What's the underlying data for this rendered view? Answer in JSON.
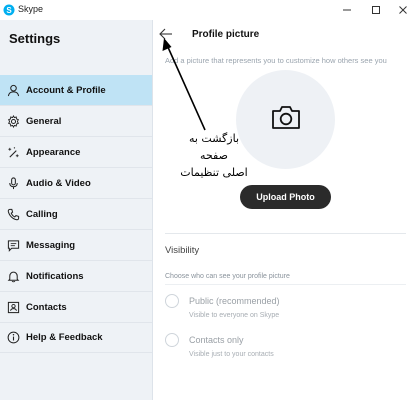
{
  "window": {
    "app_title": "Skype"
  },
  "sidebar": {
    "title": "Settings",
    "items": [
      {
        "label": "Account & Profile",
        "icon": "person-icon"
      },
      {
        "label": "General",
        "icon": "gear-icon"
      },
      {
        "label": "Appearance",
        "icon": "magic-wand-icon"
      },
      {
        "label": "Audio & Video",
        "icon": "microphone-icon"
      },
      {
        "label": "Calling",
        "icon": "phone-icon"
      },
      {
        "label": "Messaging",
        "icon": "chat-icon"
      },
      {
        "label": "Notifications",
        "icon": "bell-icon"
      },
      {
        "label": "Contacts",
        "icon": "contact-card-icon"
      },
      {
        "label": "Help & Feedback",
        "icon": "info-icon"
      }
    ],
    "active_index": 0
  },
  "main": {
    "title": "Profile picture",
    "subtitle": "Add a picture that represents you to customize how others see you",
    "upload_label": "Upload Photo",
    "visibility": {
      "title": "Visibility",
      "description": "Choose who can see your profile picture",
      "options": [
        {
          "label": "Public (recommended)",
          "desc": "Visible to everyone on Skype"
        },
        {
          "label": "Contacts only",
          "desc": "Visible just to your contacts"
        }
      ]
    }
  },
  "annotation": {
    "line1": "بازگشت به صفحه",
    "line2": "اصلی تنظیمات"
  },
  "colors": {
    "active_item": "#bfe3f5",
    "sidebar_bg": "#eef2f6",
    "button_bg": "#2b2b2b"
  }
}
